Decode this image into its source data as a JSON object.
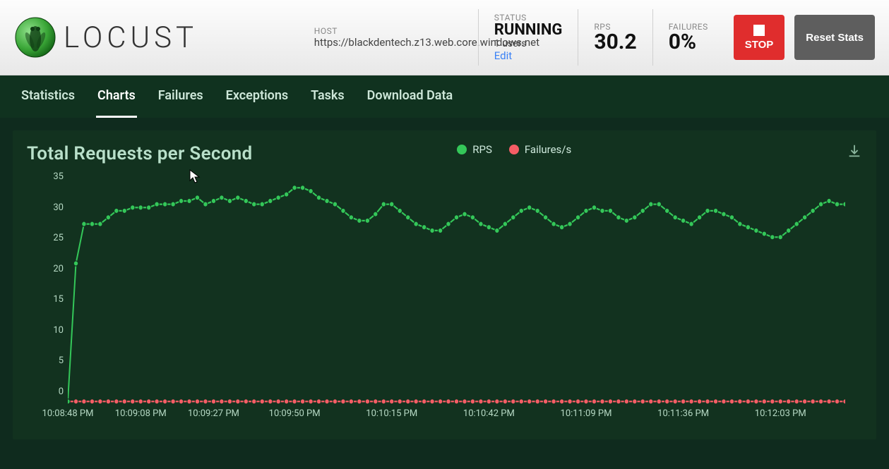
{
  "logo_text": "LOCUST",
  "header": {
    "host_label": "HOST",
    "host_value": "https://blackdentech.z13.web.core.windows.net",
    "status_label": "STATUS",
    "status_value": "RUNNING",
    "users_text": "1 users",
    "edit_label": "Edit",
    "rps_label": "RPS",
    "rps_value": "30.2",
    "failures_label": "FAILURES",
    "failures_value": "0%",
    "stop_label": "STOP",
    "reset_label": "Reset Stats"
  },
  "tabs": [
    {
      "label": "Statistics"
    },
    {
      "label": "Charts"
    },
    {
      "label": "Failures"
    },
    {
      "label": "Exceptions"
    },
    {
      "label": "Tasks"
    },
    {
      "label": "Download Data"
    }
  ],
  "active_tab": 1,
  "chart": {
    "title": "Total Requests per Second",
    "legend": {
      "rps": "RPS",
      "failures": "Failures/s"
    },
    "colors": {
      "rps": "#34c759",
      "failures": "#f55d65"
    }
  },
  "chart_data": {
    "type": "line",
    "title": "Total Requests per Second",
    "xlabel": "",
    "ylabel": "",
    "ylim": [
      0,
      35
    ],
    "y_ticks": [
      0,
      5,
      10,
      15,
      20,
      25,
      30,
      35
    ],
    "x_tick_labels": [
      "10:08:48 PM",
      "10:09:08 PM",
      "10:09:27 PM",
      "10:09:50 PM",
      "10:10:15 PM",
      "10:10:42 PM",
      "10:11:09 PM",
      "10:11:36 PM",
      "10:12:03 PM"
    ],
    "x_tick_positions": [
      0,
      9,
      18,
      28,
      40,
      52,
      64,
      76,
      88
    ],
    "series": [
      {
        "name": "RPS",
        "color": "#34c759",
        "values": [
          0,
          21,
          27,
          27,
          27,
          28,
          29,
          29,
          29.5,
          29.5,
          29.5,
          30,
          30,
          30,
          30.5,
          30.5,
          31,
          30,
          30.5,
          31,
          30.5,
          31,
          30.5,
          30,
          30,
          30.5,
          31,
          31.5,
          32.5,
          32.5,
          32,
          31,
          30.5,
          30,
          29,
          28,
          27.5,
          27.5,
          28.5,
          30,
          30,
          29,
          28,
          27,
          26.5,
          26,
          26,
          27,
          28,
          28.5,
          28,
          27,
          26.5,
          26,
          27,
          28,
          29,
          29.5,
          29,
          28,
          27,
          26.5,
          27,
          28,
          29,
          29.5,
          29,
          29,
          28,
          27.5,
          28,
          29,
          30,
          30,
          29,
          28,
          27.5,
          27,
          28,
          29,
          29,
          28.5,
          28,
          27,
          26.5,
          26,
          25.5,
          25,
          25,
          26,
          27,
          28,
          29,
          30,
          30.5,
          30,
          30
        ]
      },
      {
        "name": "Failures/s",
        "color": "#f55d65",
        "values": [
          0,
          0,
          0,
          0,
          0,
          0,
          0,
          0,
          0,
          0,
          0,
          0,
          0,
          0,
          0,
          0,
          0,
          0,
          0,
          0,
          0,
          0,
          0,
          0,
          0,
          0,
          0,
          0,
          0,
          0,
          0,
          0,
          0,
          0,
          0,
          0,
          0,
          0,
          0,
          0,
          0,
          0,
          0,
          0,
          0,
          0,
          0,
          0,
          0,
          0,
          0,
          0,
          0,
          0,
          0,
          0,
          0,
          0,
          0,
          0,
          0,
          0,
          0,
          0,
          0,
          0,
          0,
          0,
          0,
          0,
          0,
          0,
          0,
          0,
          0,
          0,
          0,
          0,
          0,
          0,
          0,
          0,
          0,
          0,
          0,
          0,
          0,
          0,
          0,
          0,
          0,
          0,
          0,
          0,
          0,
          0,
          0
        ]
      }
    ]
  }
}
